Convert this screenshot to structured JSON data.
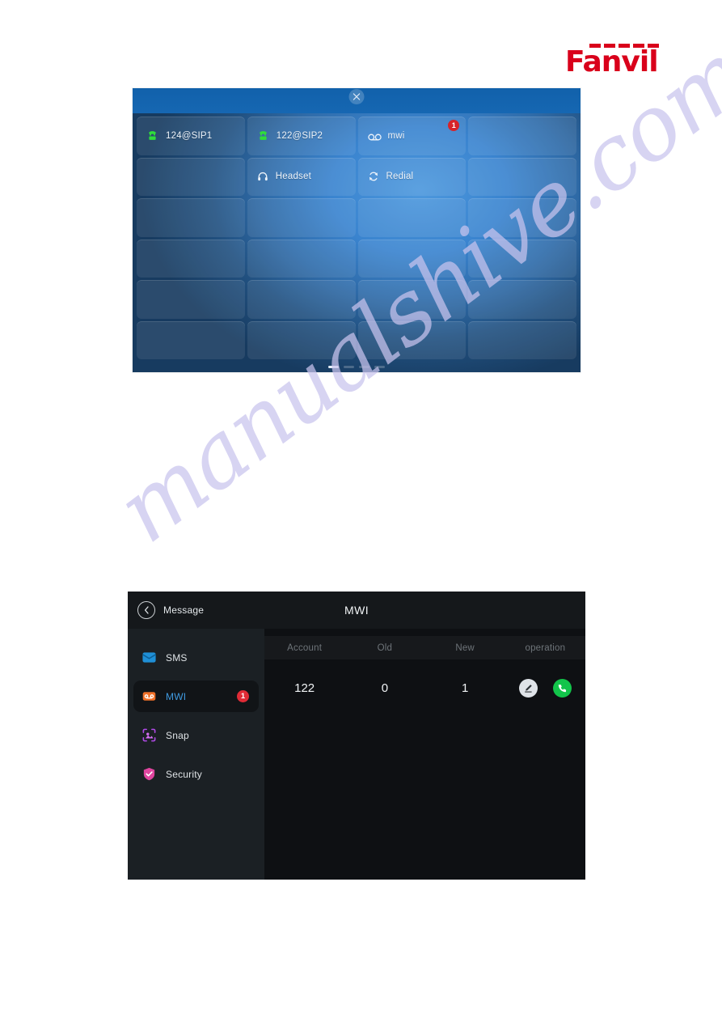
{
  "brand": {
    "logo_text": "Fanvil",
    "logo_color": "#d9001b"
  },
  "watermark": {
    "text": "manualshive.com",
    "color": "#c9c4ee"
  },
  "dss_screen": {
    "close_icon": "close-icon",
    "pages": {
      "total": 4,
      "current": 1
    },
    "keys": [
      {
        "label": "124@SIP1",
        "icon": "phone-handset-green-icon",
        "badge": ""
      },
      {
        "label": "122@SIP2",
        "icon": "phone-handset-green-icon",
        "badge": ""
      },
      {
        "label": "mwi",
        "icon": "voicemail-icon",
        "badge": "1"
      },
      {
        "label": "",
        "icon": "",
        "badge": ""
      },
      {
        "label": "",
        "icon": "",
        "badge": ""
      },
      {
        "label": "Headset",
        "icon": "headset-icon",
        "badge": ""
      },
      {
        "label": "Redial",
        "icon": "redial-icon",
        "badge": ""
      },
      {
        "label": "",
        "icon": "",
        "badge": ""
      },
      {
        "label": "",
        "icon": "",
        "badge": ""
      },
      {
        "label": "",
        "icon": "",
        "badge": ""
      },
      {
        "label": "",
        "icon": "",
        "badge": ""
      },
      {
        "label": "",
        "icon": "",
        "badge": ""
      },
      {
        "label": "",
        "icon": "",
        "badge": ""
      },
      {
        "label": "",
        "icon": "",
        "badge": ""
      },
      {
        "label": "",
        "icon": "",
        "badge": ""
      },
      {
        "label": "",
        "icon": "",
        "badge": ""
      },
      {
        "label": "",
        "icon": "",
        "badge": ""
      },
      {
        "label": "",
        "icon": "",
        "badge": ""
      },
      {
        "label": "",
        "icon": "",
        "badge": ""
      },
      {
        "label": "",
        "icon": "",
        "badge": ""
      },
      {
        "label": "",
        "icon": "",
        "badge": ""
      },
      {
        "label": "",
        "icon": "",
        "badge": ""
      },
      {
        "label": "",
        "icon": "",
        "badge": ""
      },
      {
        "label": "",
        "icon": "",
        "badge": ""
      }
    ]
  },
  "message_screen": {
    "header": {
      "back_icon": "chevron-left-icon",
      "back_label": "Message",
      "title": "MWI"
    },
    "sidebar": {
      "items": [
        {
          "label": "SMS",
          "icon": "sms-icon",
          "badge": "",
          "active": false
        },
        {
          "label": "MWI",
          "icon": "mwi-icon",
          "badge": "1",
          "active": true
        },
        {
          "label": "Snap",
          "icon": "snap-icon",
          "badge": "",
          "active": false
        },
        {
          "label": "Security",
          "icon": "security-shield-icon",
          "badge": "",
          "active": false
        }
      ]
    },
    "table": {
      "columns": [
        "Account",
        "Old",
        "New",
        "operation"
      ],
      "rows": [
        {
          "account": "122",
          "old": "0",
          "new": "1",
          "operation": [
            "edit-icon",
            "call-icon"
          ]
        }
      ]
    }
  }
}
